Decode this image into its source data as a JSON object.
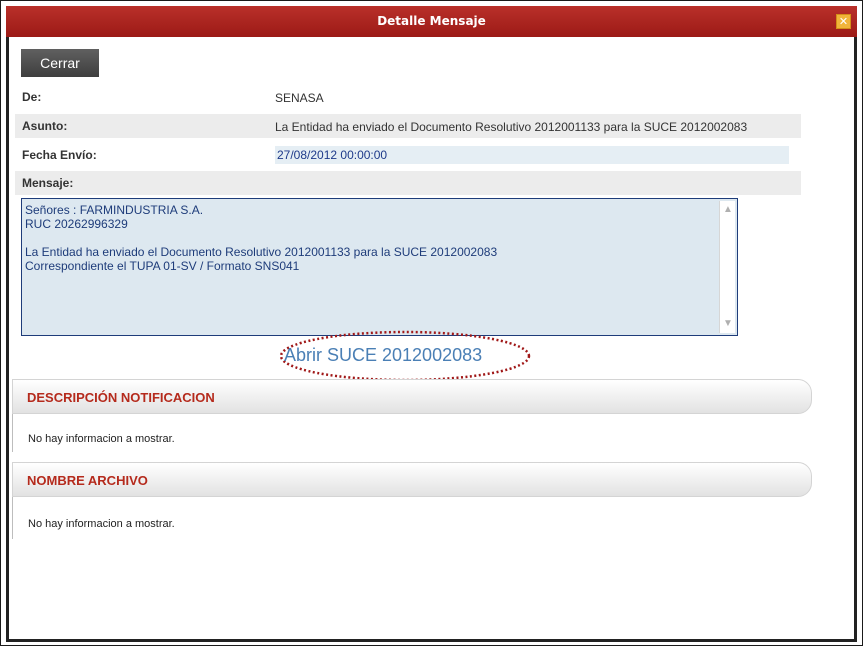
{
  "window": {
    "title": "Detalle Mensaje",
    "close_glyph": "✕"
  },
  "toolbar": {
    "close_label": "Cerrar"
  },
  "fields": {
    "de": {
      "label": "De:",
      "value": "SENASA"
    },
    "asunto": {
      "label": "Asunto:",
      "value": "La Entidad ha enviado el Documento Resolutivo 2012001133 para la SUCE 2012002083"
    },
    "fecha": {
      "label": "Fecha Envío:",
      "value": "27/08/2012 00:00:00"
    },
    "mensaje": {
      "label": "Mensaje:"
    }
  },
  "message": {
    "lines": [
      "Señores : FARMINDUSTRIA S.A.",
      "RUC 20262996329",
      "",
      "La Entidad ha enviado el Documento Resolutivo 2012001133 para la SUCE 2012002083",
      "Correspondiente el TUPA 01-SV / Formato SNS041"
    ]
  },
  "link": {
    "abrir_suce": "Abrir SUCE 2012002083"
  },
  "sections": [
    {
      "title": "DESCRIPCIÓN NOTIFICACION",
      "empty_text": "No hay informacion a mostrar."
    },
    {
      "title": "NOMBRE ARCHIVO",
      "empty_text": "No hay informacion a mostrar."
    }
  ],
  "colors": {
    "titlebar": "#a8221d",
    "section_title": "#b52a1c",
    "link": "#4a7fb5",
    "annotation_ellipse": "#a01818"
  }
}
